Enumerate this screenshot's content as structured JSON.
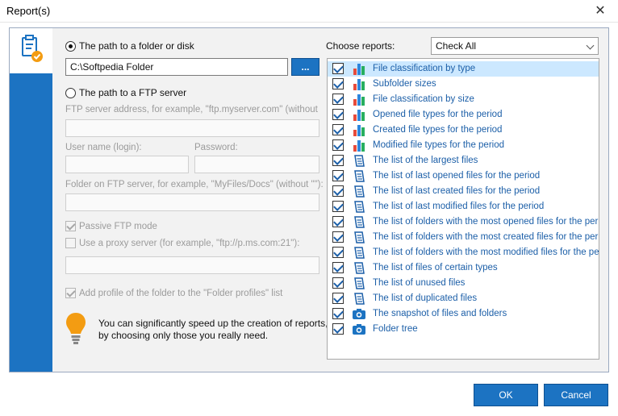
{
  "window": {
    "title": "Report(s)",
    "close_glyph": "✕"
  },
  "source": {
    "folder_option": "The path to a folder or disk",
    "folder_path": "C:\\Softpedia Folder",
    "browse_label": "...",
    "ftp_option": "The path to a FTP server",
    "ftp_address_label": "FTP server address, for example, \"ftp.myserver.com\" (without",
    "user_label": "User name (login):",
    "password_label": "Password:",
    "ftp_folder_label": "Folder on FTP server, for example, \"MyFiles/Docs\" (without \"\"):",
    "passive_label": "Passive FTP mode",
    "proxy_label": "Use a proxy server (for example, \"ftp://p.ms.com:21\"):",
    "add_profile_label": "Add profile of the folder to the \"Folder profiles\" list"
  },
  "tip": {
    "line1": "You can significantly speed up the creation of reports,",
    "line2": "by choosing only those you really need."
  },
  "reports": {
    "choose_label": "Choose reports:",
    "select_value": "Check All",
    "items": [
      {
        "label": "File classification by type",
        "icon": "bar-chart-icon"
      },
      {
        "label": "Subfolder sizes",
        "icon": "bar-chart-icon"
      },
      {
        "label": "File classification by size",
        "icon": "bar-chart-icon"
      },
      {
        "label": "Opened file types for the period",
        "icon": "bar-chart-icon"
      },
      {
        "label": "Created file types for the period",
        "icon": "bar-chart-icon"
      },
      {
        "label": "Modified file types for the period",
        "icon": "bar-chart-icon"
      },
      {
        "label": "The list of the largest files",
        "icon": "document-list-icon"
      },
      {
        "label": "The list of last opened files for the period",
        "icon": "document-list-icon"
      },
      {
        "label": "The list of last created files for the period",
        "icon": "document-list-icon"
      },
      {
        "label": "The list of last modified files for the period",
        "icon": "document-list-icon"
      },
      {
        "label": "The list of folders with the most opened files for the period",
        "icon": "document-list-icon"
      },
      {
        "label": "The list of folders with the most created files for the period",
        "icon": "document-list-icon"
      },
      {
        "label": "The list of folders with the most modified files for the period",
        "icon": "document-list-icon"
      },
      {
        "label": "The list of files of certain types",
        "icon": "document-list-icon"
      },
      {
        "label": "The list of unused files",
        "icon": "document-list-icon"
      },
      {
        "label": "The list of duplicated files",
        "icon": "document-list-icon"
      },
      {
        "label": "The snapshot of files and folders",
        "icon": "camera-icon"
      },
      {
        "label": "Folder tree",
        "icon": "camera-icon"
      }
    ]
  },
  "buttons": {
    "ok": "OK",
    "cancel": "Cancel"
  }
}
